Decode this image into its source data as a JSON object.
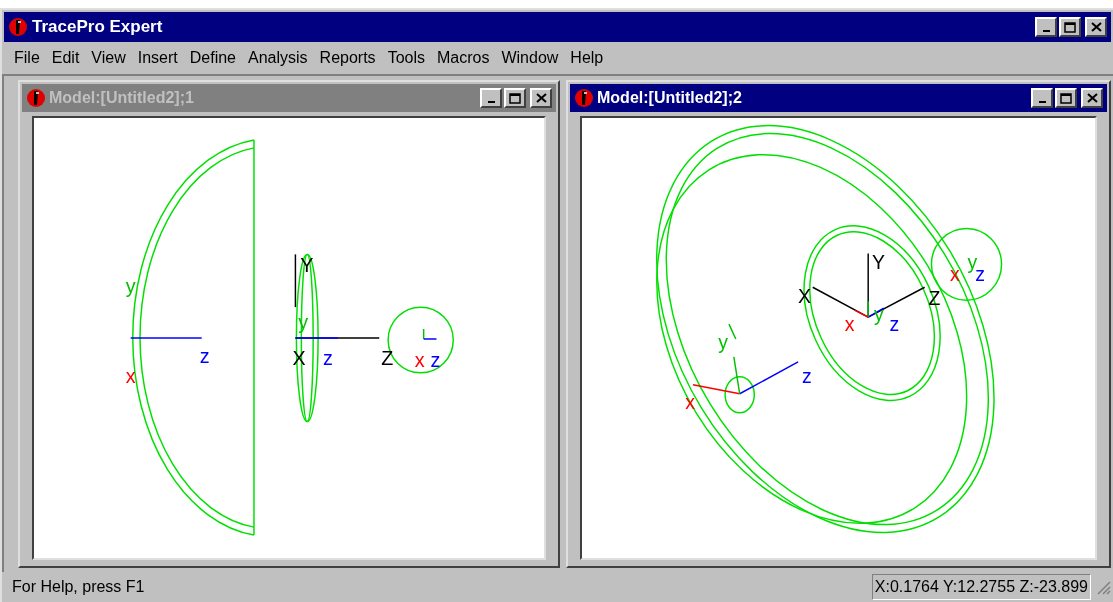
{
  "window": {
    "title": "TracePro Expert"
  },
  "menu": [
    "File",
    "Edit",
    "View",
    "Insert",
    "Define",
    "Analysis",
    "Reports",
    "Tools",
    "Macros",
    "Window",
    "Help"
  ],
  "documents": [
    {
      "title": "Model:[Untitled2];1",
      "active": false,
      "labels": [
        {
          "text": "y",
          "color": "#00c000"
        },
        {
          "text": "z",
          "color": "#0000ff"
        },
        {
          "text": "x",
          "color": "#ff0000"
        },
        {
          "text": "Y",
          "color": "#000000"
        },
        {
          "text": "y",
          "color": "#00c000"
        },
        {
          "text": "X",
          "color": "#000000"
        },
        {
          "text": "z",
          "color": "#0000ff"
        },
        {
          "text": "Z",
          "color": "#000000"
        },
        {
          "text": "x",
          "color": "#ff0000"
        },
        {
          "text": "z",
          "color": "#0000ff"
        }
      ]
    },
    {
      "title": "Model:[Untitled2];2",
      "active": true,
      "labels": [
        {
          "text": "Y",
          "color": "#000000"
        },
        {
          "text": "X",
          "color": "#000000"
        },
        {
          "text": "Z",
          "color": "#000000"
        },
        {
          "text": "y",
          "color": "#00c000"
        },
        {
          "text": "x",
          "color": "#ff0000"
        },
        {
          "text": "z",
          "color": "#0000ff"
        },
        {
          "text": "x",
          "color": "#ff0000"
        },
        {
          "text": "z",
          "color": "#0000ff"
        },
        {
          "text": "y",
          "color": "#00c000"
        },
        {
          "text": "y",
          "color": "#00c000"
        },
        {
          "text": "z",
          "color": "#0000ff"
        },
        {
          "text": "x",
          "color": "#ff0000"
        }
      ]
    }
  ],
  "status_bar": {
    "message": "For Help, press F1",
    "coordinates": "X:0.1764 Y:12.2755 Z:-23.899"
  }
}
